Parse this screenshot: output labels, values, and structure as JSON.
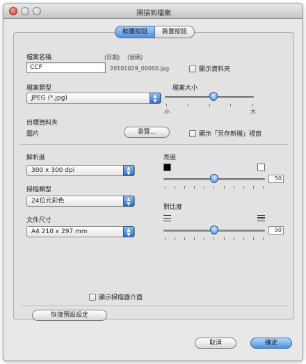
{
  "window": {
    "title": "掃描到檔案"
  },
  "tabs": [
    {
      "label": "軟體按鈕",
      "active": true
    },
    {
      "label": "裝置按鈕",
      "active": false
    }
  ],
  "file_section": {
    "name_label": "檔案名稱",
    "date_label": "(日期)",
    "number_label": "(號碼)",
    "name_value": "CCF",
    "filename_preview": "20101029_00000.jpg",
    "show_folder_label": "顯示資料夾",
    "type_label": "檔案類型",
    "type_value": "JPEG (*.jpg)",
    "size_label": "檔案大小",
    "size_small": "小",
    "size_large": "大",
    "size_fraction": 0.55,
    "dest_label": "目標資料夾",
    "dest_value": "圖片",
    "browse_label": "瀏覽...",
    "show_saveas_label": "顯示「另存新檔」視窗"
  },
  "scan_section": {
    "resolution_label": "解析度",
    "resolution_value": "300 x 300 dpi",
    "scan_type_label": "掃描類型",
    "scan_type_value": "24位元彩色",
    "doc_size_label": "文件尺寸",
    "doc_size_value": "A4 210 x 297 mm",
    "brightness_label": "亮度",
    "brightness_value": "50",
    "brightness_fraction": 0.5,
    "contrast_label": "對比度",
    "contrast_value": "50",
    "contrast_fraction": 0.5,
    "show_interface_label": "顯示掃描器介面"
  },
  "buttons": {
    "restore": "恢復預設設定",
    "cancel": "取消",
    "ok": "確定"
  },
  "colors": {
    "accent": "#4f8fdc",
    "close": "#d9342b"
  }
}
